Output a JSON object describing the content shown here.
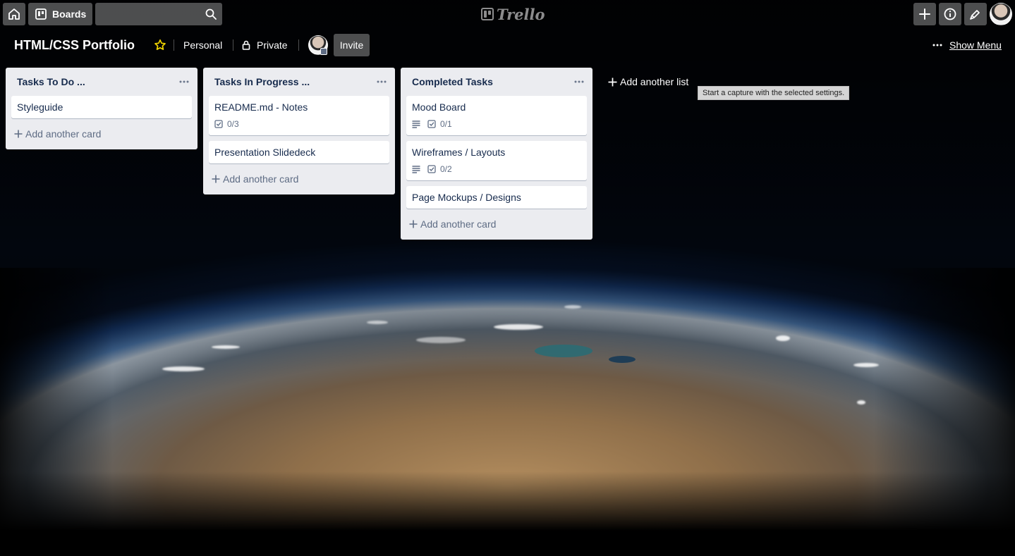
{
  "header": {
    "boards_label": "Boards",
    "search_placeholder": "",
    "logo_text": "Trello"
  },
  "board": {
    "title": "HTML/CSS Portfolio",
    "team": "Personal",
    "visibility": "Private",
    "invite_label": "Invite",
    "show_menu_label": "Show Menu"
  },
  "lists": [
    {
      "title": "Tasks To Do ...",
      "add_card_label": "Add another card",
      "cards": [
        {
          "title": "Styleguide"
        }
      ]
    },
    {
      "title": "Tasks In Progress ...",
      "add_card_label": "Add another card",
      "cards": [
        {
          "title": "README.md - Notes",
          "checklist": "0/3"
        },
        {
          "title": "Presentation Slidedeck"
        }
      ]
    },
    {
      "title": "Completed Tasks",
      "add_card_label": "Add another card",
      "cards": [
        {
          "title": "Mood Board",
          "checklist": "0/1",
          "has_description": true
        },
        {
          "title": "Wireframes / Layouts",
          "checklist": "0/2",
          "has_description": true
        },
        {
          "title": "Page Mockups / Designs"
        }
      ]
    }
  ],
  "add_list_label": "Add another list",
  "tooltip": "Start a capture with the selected settings.",
  "icons": {
    "home": "home-icon",
    "boards": "boards-icon",
    "search": "search-icon",
    "plus": "plus-icon",
    "info": "info-icon",
    "notification": "notification-icon",
    "star": "star-icon",
    "lock": "lock-icon",
    "more": "more-icon",
    "description": "description-icon",
    "checklist": "checklist-icon"
  },
  "colors": {
    "star": "#f2d600",
    "list_bg": "#ebecf0",
    "card_text": "#172b4d",
    "muted_text": "#5e6c84"
  }
}
